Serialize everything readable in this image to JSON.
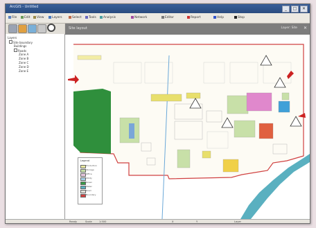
{
  "window": {
    "title": "ArcGIS - Untitled",
    "controls": [
      "_",
      "□",
      "✕"
    ]
  },
  "toolbar": {
    "items": [
      {
        "label": "File",
        "icon": "file-icon",
        "color": "#5a7fbf"
      },
      {
        "label": "Edit",
        "icon": "edit-icon",
        "color": "#6a9a5a"
      },
      {
        "label": "View",
        "icon": "view-icon",
        "color": "#9a8a4a"
      },
      {
        "label": "Layers",
        "icon": "layers-icon",
        "color": "#4a7abf"
      },
      {
        "label": "Select",
        "icon": "select-icon",
        "color": "#bf6a4a"
      },
      {
        "label": "Tools",
        "icon": "tools-icon",
        "color": "#6a6abf"
      },
      {
        "label": "Analysis",
        "icon": "analysis-icon",
        "color": "#4aa0a0"
      },
      {
        "label": "Network",
        "icon": "network-icon",
        "color": "#a04aa0"
      },
      {
        "label": "Editor",
        "icon": "editor-icon",
        "color": "#7a7a7a"
      },
      {
        "label": "Report",
        "icon": "report-icon",
        "color": "#cc3333"
      },
      {
        "label": "Help",
        "icon": "help-icon",
        "color": "#3355cc"
      },
      {
        "label": "Stop",
        "icon": "stop-icon",
        "color": "#222222"
      }
    ]
  },
  "tree": {
    "root": "Layers",
    "items": [
      "Site boundary",
      "Buildings",
      "Roads",
      "Zone A",
      "Zone B",
      "Zone C",
      "Zone D",
      "Zone E"
    ]
  },
  "document": {
    "title": "Site layout",
    "right_label": "Layer: Site",
    "close": "✕"
  },
  "legend": {
    "title": "Legend",
    "items": [
      {
        "label": "Production",
        "color": "#e8e8a0"
      },
      {
        "label": "Storage",
        "color": "#c8e0a8"
      },
      {
        "label": "Office",
        "color": "#e8c8e0"
      },
      {
        "label": "Utility",
        "color": "#a8d0e8"
      },
      {
        "label": "Green",
        "color": "#3a9a48"
      },
      {
        "label": "Water",
        "color": "#5ab0c0"
      },
      {
        "label": "Road",
        "color": "#e0e0d8"
      },
      {
        "label": "Boundary",
        "color": "#d04040"
      }
    ]
  },
  "status": {
    "items": [
      "Ready",
      "Scale",
      "1:500",
      "X",
      "Y",
      "Layer"
    ]
  },
  "colors": {
    "accent": "#2a4b7f",
    "map_boundary": "#d04040",
    "water": "#5ab0c0",
    "green_area": "#2f8f3c"
  }
}
